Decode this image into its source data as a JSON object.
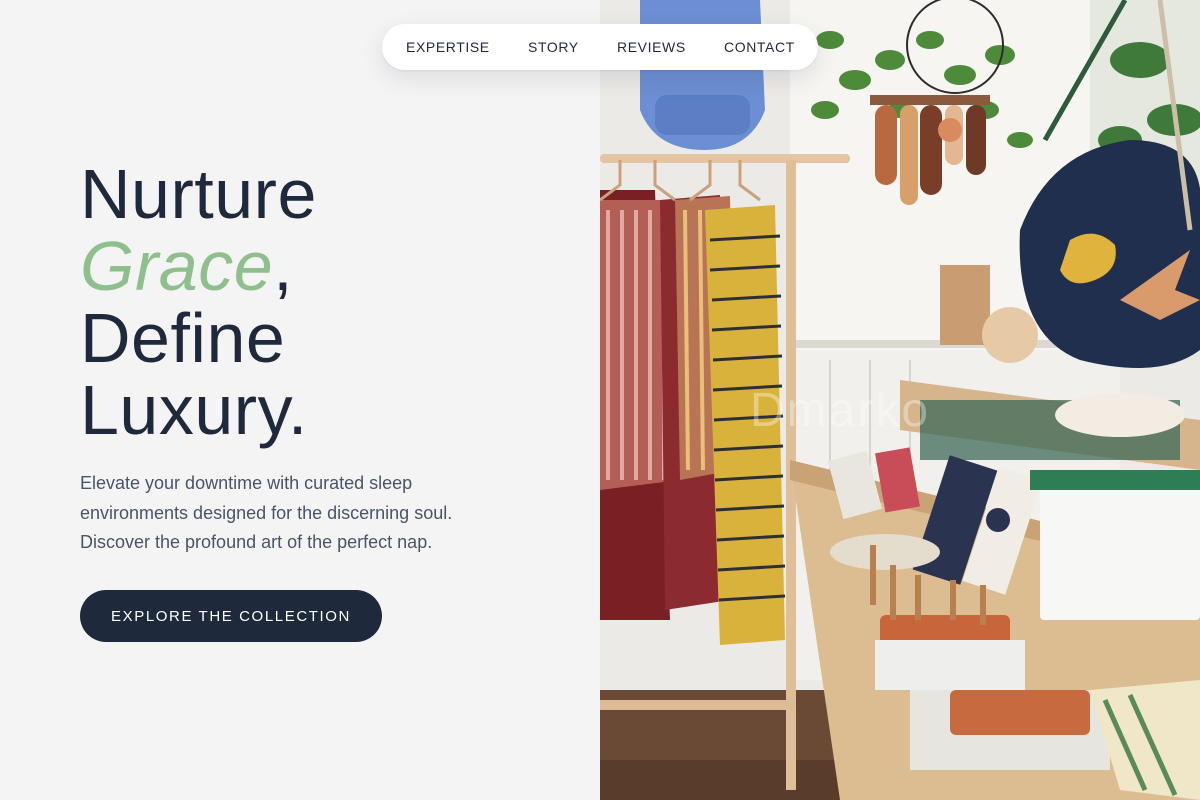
{
  "nav": {
    "items": [
      {
        "label": "EXPERTISE"
      },
      {
        "label": "STORY"
      },
      {
        "label": "REVIEWS"
      },
      {
        "label": "CONTACT"
      }
    ]
  },
  "hero": {
    "headline": {
      "line1": "Nurture",
      "accent": "Grace",
      "accent_suffix": ",",
      "line3": "Define",
      "line4": "Luxury."
    },
    "description": {
      "line1": "Elevate your downtime with curated sleep",
      "line2": "environments designed for the discerning soul.",
      "line3": "Discover the profound art of the perfect nap."
    },
    "cta_label": "EXPLORE THE COLLECTION"
  },
  "image": {
    "watermark": "Dmarko"
  },
  "colors": {
    "text_dark": "#1e293b",
    "accent_green": "#8fbf8c",
    "body_text": "#475569",
    "background": "#f4f4f5",
    "button_bg": "#1e293b"
  },
  "icons": [
    "shop-photo-image"
  ]
}
